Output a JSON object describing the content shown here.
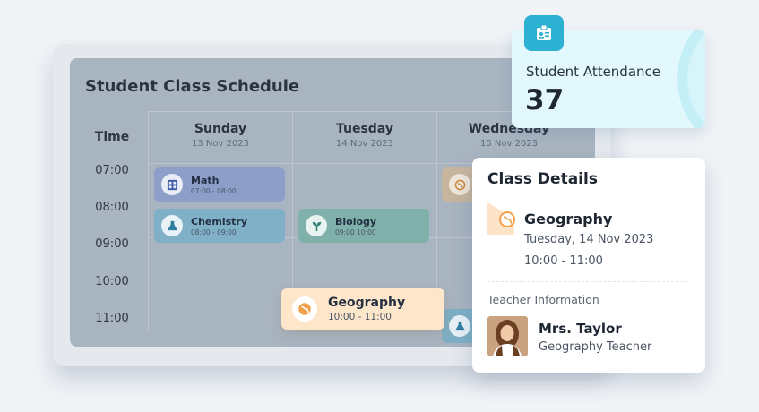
{
  "schedule": {
    "title": "Student Class Schedule",
    "time_header": "Time",
    "times": [
      "07:00",
      "08:00",
      "09:00",
      "10:00",
      "11:00"
    ],
    "days": [
      {
        "name": "Sunday",
        "date": "13 Nov 2023"
      },
      {
        "name": "Tuesday",
        "date": "14 Nov 2023"
      },
      {
        "name": "Wednesday",
        "date": "15 Nov 2023"
      }
    ],
    "events": {
      "math": {
        "name": "Math",
        "time": "07:00 - 08:00",
        "icon": "calculator-icon"
      },
      "chemistry": {
        "name": "Chemistry",
        "time": "08:00 - 09:00",
        "icon": "flask-icon"
      },
      "biology": {
        "name": "Biology",
        "time": "09:00 10:00",
        "icon": "sprout-icon"
      }
    }
  },
  "attendance": {
    "label": "Student Attendance",
    "value": "37",
    "icon": "id-badge-icon"
  },
  "details": {
    "title": "Class Details",
    "subject": "Geography",
    "date": "Tuesday, 14 Nov 2023",
    "time": "10:00 - 11:00",
    "teacher_section_label": "Teacher Information",
    "teacher_name": "Mrs. Taylor",
    "teacher_role": "Geography Teacher",
    "icon": "globe-icon"
  },
  "chip": {
    "name": "Geography",
    "time": "10:00 - 11:00",
    "icon": "globe-icon"
  },
  "colors": {
    "accent_cyan": "#2cb1d3",
    "geography_orange": "#f0a04b",
    "geography_bg": "#fde6c9"
  }
}
